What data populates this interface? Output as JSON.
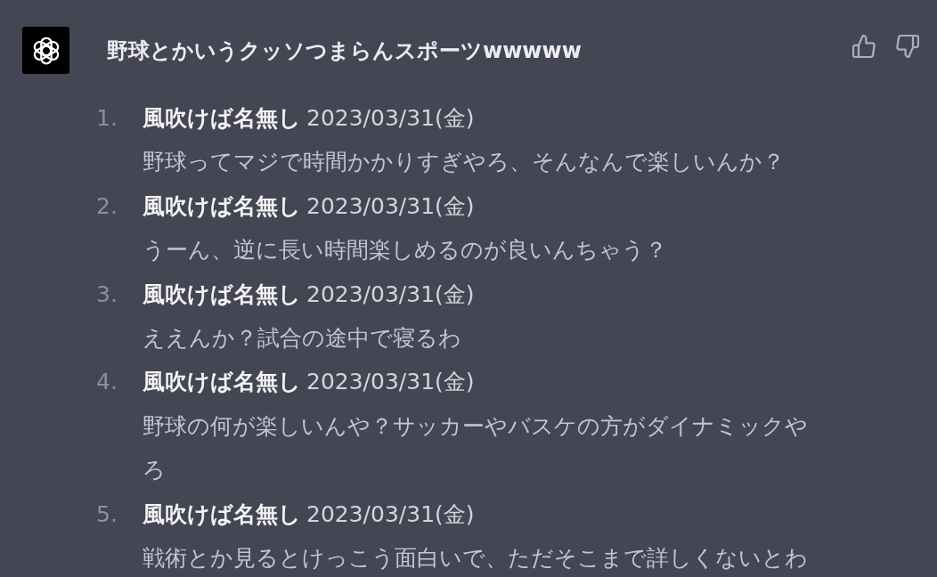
{
  "message": {
    "title": "野球とかいうクッソつまらんスポーツwwwww"
  },
  "posts": [
    {
      "number": "1.",
      "name": "風吹けば名無し",
      "date": "2023/03/31(金)",
      "text": "野球ってマジで時間かかりすぎやろ、そんなんで楽しいんか？"
    },
    {
      "number": "2.",
      "name": "風吹けば名無し",
      "date": "2023/03/31(金)",
      "text": "うーん、逆に長い時間楽しめるのが良いんちゃう？"
    },
    {
      "number": "3.",
      "name": "風吹けば名無し",
      "date": "2023/03/31(金)",
      "text": "ええんか？試合の途中で寝るわ"
    },
    {
      "number": "4.",
      "name": "風吹けば名無し",
      "date": "2023/03/31(金)",
      "text": "野球の何が楽しいんや？サッカーやバスケの方がダイナミックやろ"
    },
    {
      "number": "5.",
      "name": "風吹けば名無し",
      "date": "2023/03/31(金)",
      "text": "戦術とか見るとけっこう面白いで、ただそこまで詳しくないとわ"
    }
  ]
}
